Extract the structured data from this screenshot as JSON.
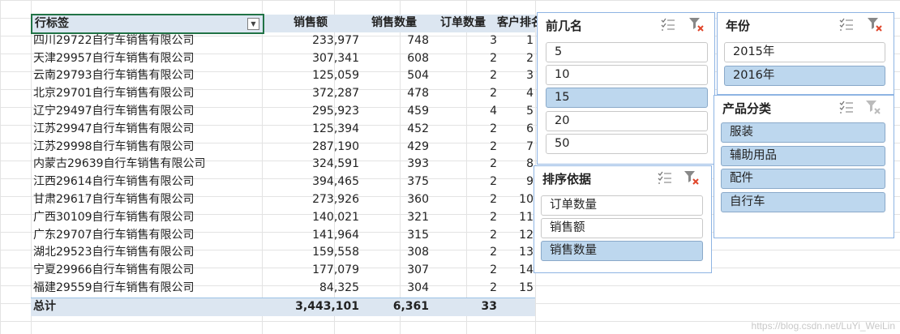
{
  "pivot": {
    "headers": {
      "name": "行标签",
      "amount": "销售额",
      "qty": "销售数量",
      "orders": "订单数量",
      "rank": "客户排名"
    },
    "rows": [
      {
        "name": "四川29722自行车销售有限公司",
        "amount": "233,977",
        "qty": "748",
        "orders": "3",
        "rank": "1"
      },
      {
        "name": "天津29957自行车销售有限公司",
        "amount": "307,341",
        "qty": "608",
        "orders": "2",
        "rank": "2"
      },
      {
        "name": "云南29793自行车销售有限公司",
        "amount": "125,059",
        "qty": "504",
        "orders": "2",
        "rank": "3"
      },
      {
        "name": "北京29701自行车销售有限公司",
        "amount": "372,287",
        "qty": "478",
        "orders": "2",
        "rank": "4"
      },
      {
        "name": "辽宁29497自行车销售有限公司",
        "amount": "295,923",
        "qty": "459",
        "orders": "4",
        "rank": "5"
      },
      {
        "name": "江苏29947自行车销售有限公司",
        "amount": "125,394",
        "qty": "452",
        "orders": "2",
        "rank": "6"
      },
      {
        "name": "江苏29998自行车销售有限公司",
        "amount": "287,190",
        "qty": "429",
        "orders": "2",
        "rank": "7"
      },
      {
        "name": "内蒙古29639自行车销售有限公司",
        "amount": "324,591",
        "qty": "393",
        "orders": "2",
        "rank": "8"
      },
      {
        "name": "江西29614自行车销售有限公司",
        "amount": "394,465",
        "qty": "375",
        "orders": "2",
        "rank": "9"
      },
      {
        "name": "甘肃29617自行车销售有限公司",
        "amount": "273,926",
        "qty": "360",
        "orders": "2",
        "rank": "10"
      },
      {
        "name": "广西30109自行车销售有限公司",
        "amount": "140,021",
        "qty": "321",
        "orders": "2",
        "rank": "11"
      },
      {
        "name": "广东29707自行车销售有限公司",
        "amount": "141,964",
        "qty": "315",
        "orders": "2",
        "rank": "12"
      },
      {
        "name": "湖北29523自行车销售有限公司",
        "amount": "159,558",
        "qty": "308",
        "orders": "2",
        "rank": "13"
      },
      {
        "name": "宁夏29966自行车销售有限公司",
        "amount": "177,079",
        "qty": "307",
        "orders": "2",
        "rank": "14"
      },
      {
        "name": "福建29559自行车销售有限公司",
        "amount": "84,325",
        "qty": "304",
        "orders": "2",
        "rank": "15"
      }
    ],
    "total": {
      "name": "总计",
      "amount": "3,443,101",
      "qty": "6,361",
      "orders": "33"
    }
  },
  "slicers": {
    "topn": {
      "title": "前几名",
      "items": [
        "5",
        "10",
        "15",
        "20",
        "50"
      ],
      "selected": "15"
    },
    "year": {
      "title": "年份",
      "items": [
        "2015年",
        "2016年"
      ],
      "selected": "2016年"
    },
    "category": {
      "title": "产品分类",
      "items": [
        "服装",
        "辅助用品",
        "配件",
        "自行车"
      ],
      "selected": "all"
    },
    "sortby": {
      "title": "排序依据",
      "items": [
        "订单数量",
        "销售额",
        "销售数量"
      ],
      "selected": "销售数量"
    }
  },
  "watermark": "https://blog.csdn.net/LuYi_WeiLin",
  "colors": {
    "header_bg": "#dce6f1",
    "selected_item": "#bdd7ee",
    "slicer_border": "#8eb4e3",
    "active_cell": "#217346"
  }
}
